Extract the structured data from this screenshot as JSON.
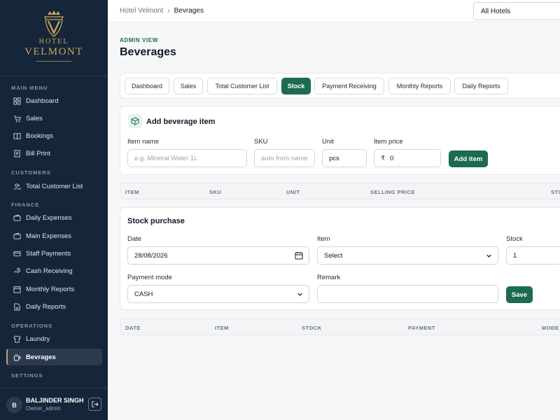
{
  "app": {
    "brand_line1": "HOTEL",
    "brand_line2": "VELMONT",
    "accent_color": "#1e6b4f",
    "gold_color": "#c9a55a",
    "sidebar_color": "#16263a"
  },
  "sidebar": {
    "sections": [
      {
        "label": "MAIN MENU"
      },
      {
        "label": "CUSTOMERS"
      },
      {
        "label": "FINANCE"
      },
      {
        "label": "OPERATIONS"
      },
      {
        "label": "SETTINGS"
      }
    ],
    "items": [
      {
        "label": "Dashboard",
        "icon": "grid-icon"
      },
      {
        "label": "Sales",
        "icon": "cart-icon"
      },
      {
        "label": "Bookings",
        "icon": "book-icon"
      },
      {
        "label": "Bill Print",
        "icon": "receipt-icon"
      },
      {
        "label": "Total Customer List",
        "icon": "users-icon"
      },
      {
        "label": "Daily Expenses",
        "icon": "wallet-icon"
      },
      {
        "label": "Main Expenses",
        "icon": "wallet-icon"
      },
      {
        "label": "Staff Payments",
        "icon": "card-icon"
      },
      {
        "label": "Cash Receiving",
        "icon": "cash-icon"
      },
      {
        "label": "Monthly Reports",
        "icon": "calendar-icon"
      },
      {
        "label": "Daily Reports",
        "icon": "file-icon"
      },
      {
        "label": "Laundry",
        "icon": "shirt-icon"
      },
      {
        "label": "Bevrages",
        "icon": "cup-icon",
        "active": true
      }
    ],
    "user": {
      "initial": "B",
      "name": "BALJINDER SINGH",
      "role": "Owner_admin"
    }
  },
  "topbar": {
    "breadcrumb": [
      "Hotel Velmont",
      "Bevrages"
    ],
    "hotel_select": "All Hotels"
  },
  "page": {
    "eyebrow": "ADMIN VIEW",
    "title": "Beverages"
  },
  "tabs": [
    {
      "label": "Dashboard"
    },
    {
      "label": "Sales"
    },
    {
      "label": "Total Customer List"
    },
    {
      "label": "Stock",
      "active": true
    },
    {
      "label": "Payment Receiving"
    },
    {
      "label": "Monthly Reports"
    },
    {
      "label": "Daily Reports"
    }
  ],
  "add_item": {
    "title": "Add beverage item",
    "name_label": "Item name",
    "name_placeholder": "e.g. Mineral Water 1L",
    "sku_label": "SKU",
    "sku_placeholder": "auto from name",
    "unit_label": "Unit",
    "unit_value": "pcs",
    "price_label": "Item price",
    "currency_symbol": "₹",
    "price_value": "0",
    "button": "Add item"
  },
  "items_table": {
    "columns": [
      "ITEM",
      "SKU",
      "UNIT",
      "SELLING PRICE",
      "STO"
    ]
  },
  "stock_purchase": {
    "title": "Stock purchase",
    "date_label": "Date",
    "date_value": "28/08/2026",
    "item_label": "Item",
    "item_value": "Select",
    "stock_label": "Stock",
    "stock_value": "1",
    "payment_label": "Payment mode",
    "payment_value": "CASH",
    "remark_label": "Remark",
    "remark_value": "",
    "button": "Save"
  },
  "purchase_table": {
    "columns": [
      "DATE",
      "ITEM",
      "STOCK",
      "PAYMENT",
      "MODE"
    ]
  }
}
